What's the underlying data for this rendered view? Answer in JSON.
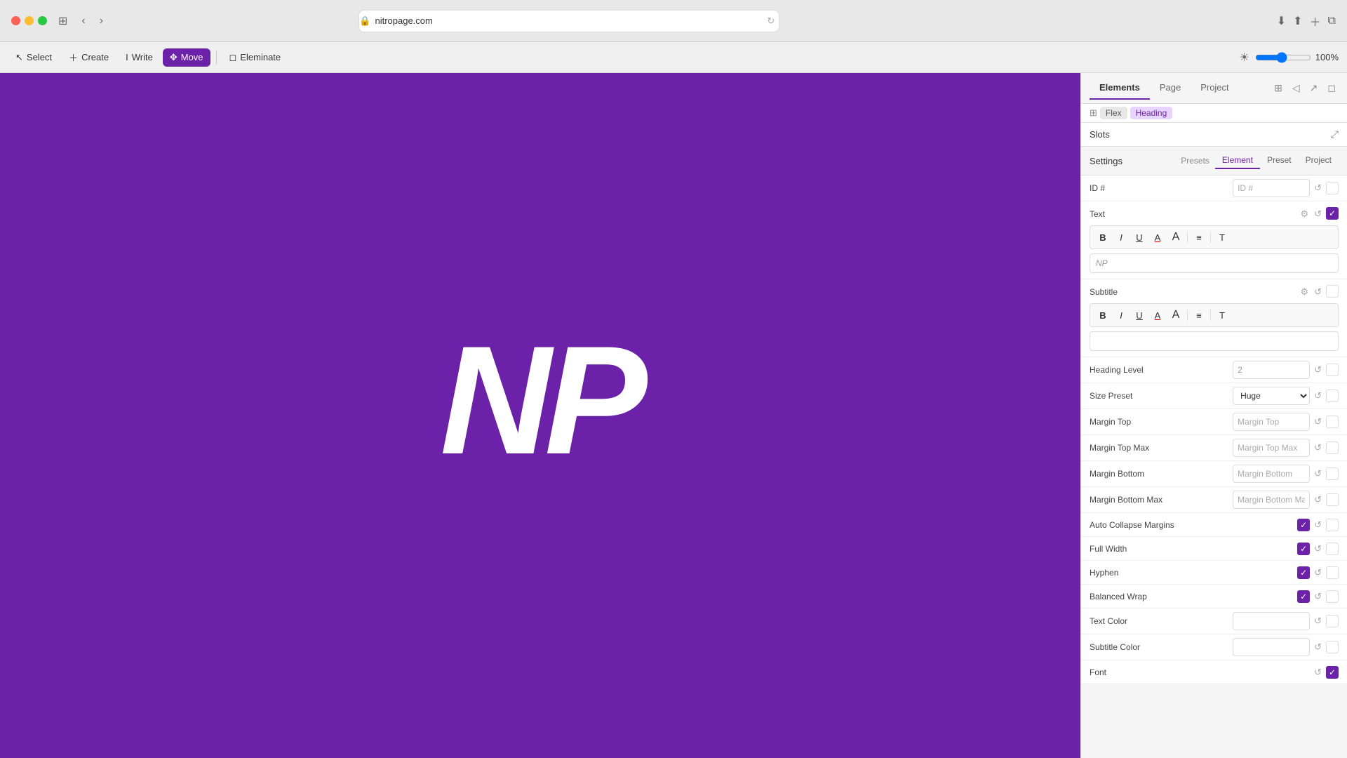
{
  "browser": {
    "url": "nitropage.com",
    "reload_title": "reload"
  },
  "toolbar": {
    "select_label": "Select",
    "create_label": "Create",
    "write_label": "Write",
    "move_label": "Move",
    "eliminate_label": "Eleminate",
    "zoom_value": "100%"
  },
  "panel": {
    "tabs": [
      "Elements",
      "Page",
      "Project"
    ],
    "active_tab": "Elements",
    "breadcrumb": [
      "Flex",
      "Heading"
    ]
  },
  "slots": {
    "title": "Slots"
  },
  "settings": {
    "title": "Settings",
    "tabs": [
      "Element",
      "Preset",
      "Project"
    ],
    "active_tab": "Element",
    "presets_label": "Presets",
    "fields": {
      "id_label": "ID #",
      "id_placeholder": "ID #",
      "text_label": "Text",
      "text_content": "NP",
      "subtitle_label": "Subtitle",
      "heading_level_label": "Heading Level",
      "heading_level_value": "2",
      "size_preset_label": "Size Preset",
      "size_preset_value": "Huge",
      "margin_top_label": "Margin Top",
      "margin_top_placeholder": "Margin Top",
      "margin_top_max_label": "Margin Top Max",
      "margin_top_max_placeholder": "Margin Top Max",
      "margin_bottom_label": "Margin Bottom",
      "margin_bottom_placeholder": "Margin Bottom",
      "margin_bottom_max_label": "Margin Bottom Max",
      "margin_bottom_max_placeholder": "Margin Bottom Max",
      "auto_collapse_label": "Auto Collapse Margins",
      "full_width_label": "Full Width",
      "hyphen_label": "Hyphen",
      "balanced_wrap_label": "Balanced Wrap",
      "text_color_label": "Text Color",
      "subtitle_color_label": "Subtitle Color",
      "font_label": "Font"
    }
  },
  "canvas": {
    "logo_text": "NP"
  },
  "icons": {
    "bold": "B",
    "italic": "I",
    "underline": "U",
    "color_a": "A",
    "font_size": "A",
    "align_left": "≡",
    "clear_format": "T"
  }
}
